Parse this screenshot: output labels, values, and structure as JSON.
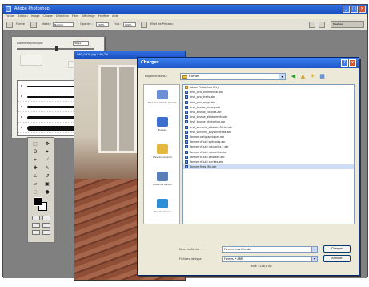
{
  "app": {
    "title": "Adobe Photoshop",
    "menu": [
      "Fichier",
      "Edition",
      "Image",
      "Calque",
      "Sélection",
      "Filtre",
      "Affichage",
      "Fenêtre",
      "Aide"
    ],
    "options": {
      "brush_label": "Forme :",
      "mode_label": "Mode :",
      "mode_value": "Normal",
      "opacity_label": "Opacité :",
      "opacity_value": "100%",
      "flow_label": "Flux :",
      "flow_value": "100%",
      "airbrush_label": "Effet de Pinceau",
      "panel_well": "Palettes"
    }
  },
  "brush_panel": {
    "diameter_label": "Diamètre principal",
    "diameter_value": "39 px",
    "brushes": [
      {
        "thickness": 1
      },
      {
        "thickness": 2
      },
      {
        "thickness": 3
      },
      {
        "thickness": 4
      },
      {
        "thickness": 6
      }
    ]
  },
  "document": {
    "title": "IMG_0016.jpg à 66,7%"
  },
  "dialog": {
    "title": "Charger",
    "look_in_label": "Regarder dans :",
    "look_in_value": "Formes",
    "places": [
      {
        "label": "Mes documents récents",
        "color": "#6d8fd8"
      },
      {
        "label": "Bureau",
        "color": "#3d6fd0"
      },
      {
        "label": "Mes documents",
        "color": "#e3b83c"
      },
      {
        "label": "Poste de travail",
        "color": "#5a7fb8"
      },
      {
        "label": "Favoris réseau",
        "color": "#2f8fd6"
      }
    ],
    "files": [
      {
        "name": "Adobe Photoshop Only",
        "folder": true
      },
      {
        "name": "brsh_pinc_ornemental.abr",
        "folder": false
      },
      {
        "name": "brsh_pinc_traits.abr",
        "folder": false
      },
      {
        "name": "brsh_pinc_rndgr.abr",
        "folder": false
      },
      {
        "name": "brsh_brushe_pinsep.abr",
        "folder": false
      },
      {
        "name": "brsh_brushe_calques.abr",
        "folder": false
      },
      {
        "name": "brsh_brushe_aléatoireSéc.abr",
        "folder": false
      },
      {
        "name": "brsh_brushe_photoshop.abr",
        "folder": false
      },
      {
        "name": "brsh_sanseria_aléatoireStyles.abr",
        "folder": false
      },
      {
        "name": "brsh_sanseria_paysfinStroke.abr",
        "folder": false
      },
      {
        "name": "Formes calligraphiques.abr",
        "folder": false
      },
      {
        "name": "Formes d'outil spéciales.abr",
        "folder": false
      },
      {
        "name": "Formes d'outil naturelles 2.abr",
        "folder": false
      },
      {
        "name": "Formes d'outil naturelles.abr",
        "folder": false
      },
      {
        "name": "Formes d'outil ombrées.abr",
        "folder": false
      },
      {
        "name": "Formes d'outil carrées.abr",
        "folder": false
      },
      {
        "name": "Formes fines Mix.abr",
        "folder": false
      }
    ],
    "filename_label": "Nom du fichier :",
    "filename_value": "Formes fines Mix.abr",
    "filetype_label": "Fichiers de type :",
    "filetype_value": "Formes (*.ABR)",
    "load_button": "Charger",
    "cancel_button": "Annuler",
    "size_label": "Taille : 128,8 Ko"
  }
}
